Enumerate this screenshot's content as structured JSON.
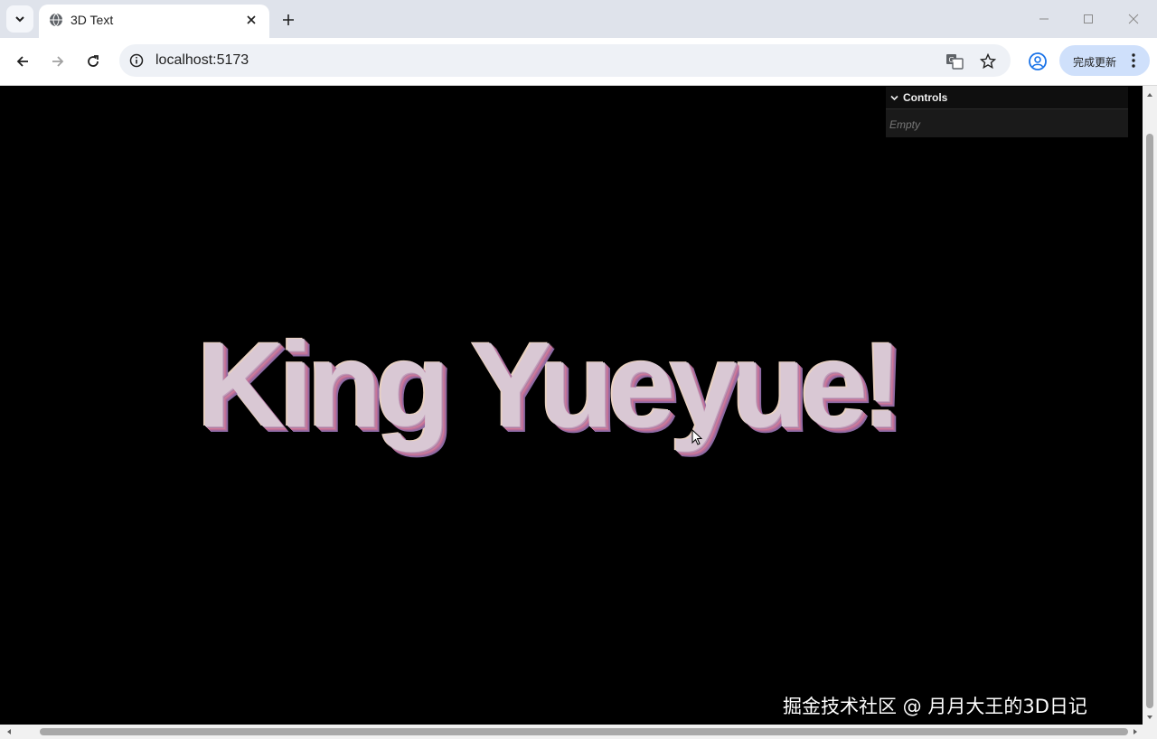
{
  "browser": {
    "tab_title": "3D Text",
    "url": "localhost:5173",
    "update_button_label": "完成更新"
  },
  "icons": {
    "tab_search": "chevron-down-icon",
    "favicon": "globe-icon",
    "tab_close": "close-icon",
    "new_tab": "plus-icon",
    "back": "arrow-left-icon",
    "forward": "arrow-right-icon",
    "reload": "reload-icon",
    "site_info": "info-icon",
    "translate": "translate-icon",
    "bookmark": "star-icon",
    "profile": "profile-icon",
    "menu": "more-vert-icon"
  },
  "scene": {
    "text": "King Yueyue!",
    "background_color": "#000000"
  },
  "gui": {
    "title": "Controls",
    "empty_label": "Empty"
  },
  "watermark": "掘金技术社区 @ 月月大王的3D日记"
}
